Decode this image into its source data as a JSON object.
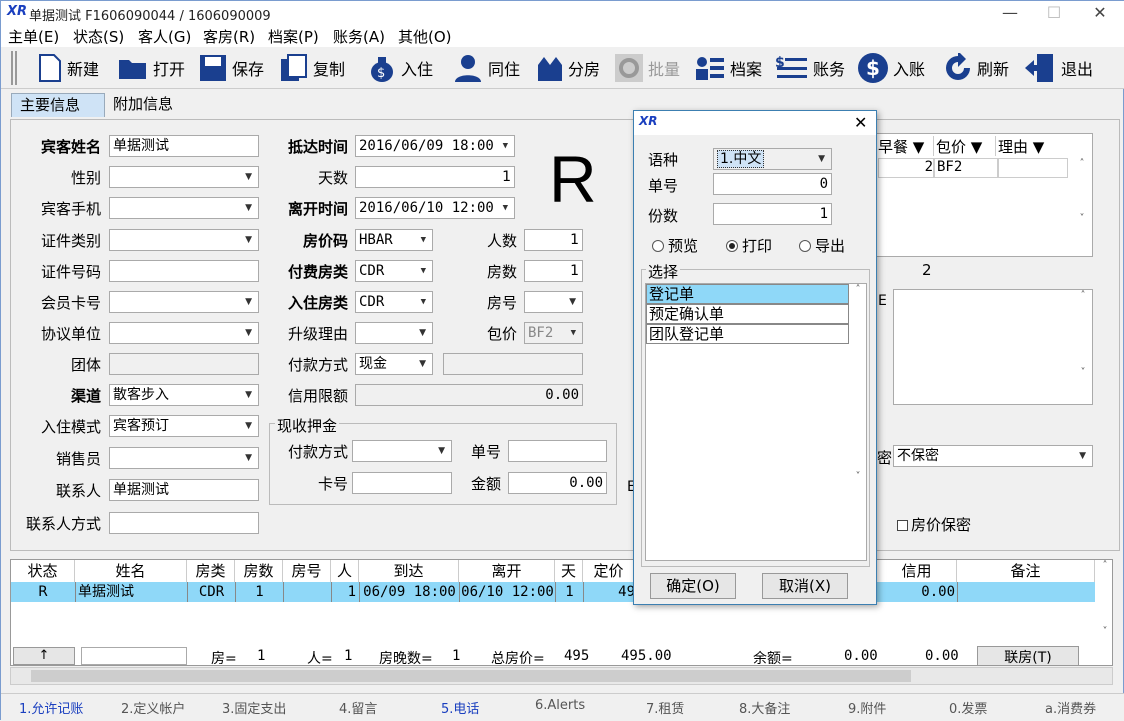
{
  "window": {
    "title": "单据测试  F1606090044  /  1606090009"
  },
  "menu": [
    "主单(E)",
    "状态(S)",
    "客人(G)",
    "客房(R)",
    "档案(P)",
    "账务(A)",
    "其他(O)"
  ],
  "toolbar": {
    "new": "新建",
    "open": "打开",
    "save": "保存",
    "copy": "复制",
    "checkin": "入住",
    "share": "同住",
    "split": "分房",
    "batch": "批量",
    "profile": "档案",
    "account": "账务",
    "post": "入账",
    "refresh": "刷新",
    "exit": "退出"
  },
  "tabs": {
    "main": "主要信息",
    "extra": "附加信息"
  },
  "form": {
    "guest_name_label": "宾客姓名",
    "guest_name": "单据测试",
    "gender_label": "性别",
    "mobile_label": "宾客手机",
    "id_type_label": "证件类别",
    "id_no_label": "证件号码",
    "member_label": "会员卡号",
    "company_label": "协议单位",
    "group_label": "团体",
    "channel_label": "渠道",
    "channel": "散客步入",
    "mode_label": "入住模式",
    "mode": "宾客预订",
    "sales_label": "销售员",
    "contact_label": "联系人",
    "contact": "单据测试",
    "contact_way_label": "联系人方式",
    "arrival_label": "抵达时间",
    "arrival": "2016/06/09 18:00",
    "days_label": "天数",
    "days": "1",
    "departure_label": "离开时间",
    "departure": "2016/06/10 12:00",
    "ratecode_label": "房价码",
    "ratecode": "HBAR",
    "pay_roomtype_label": "付费房类",
    "pay_roomtype": "CDR",
    "roomtype_label": "入住房类",
    "roomtype": "CDR",
    "upgrade_label": "升级理由",
    "payment_label": "付款方式",
    "payment": "现金",
    "credit_label": "信用限额",
    "credit": "0.00",
    "persons_label": "人数",
    "persons": "1",
    "rooms_label": "房数",
    "rooms": "1",
    "roomno_label": "房号",
    "package_label": "包价",
    "package": "BF2",
    "deposit_group": "现收押金",
    "dep_pay_label": "付款方式",
    "dep_card_label": "卡号",
    "dep_no_label": "单号",
    "dep_amount_label": "金额",
    "dep_amount": "0.00",
    "big_status": "R",
    "right_cols": [
      "早餐 ▼",
      "包价 ▼",
      "理由 ▼"
    ],
    "right_row": [
      "2",
      "BF2",
      ""
    ],
    "right_count": "2",
    "secret_value": "不保密",
    "rate_secret": "房价保密",
    "partial_label_e": "E",
    "partial_label_ia": "E",
    "partial_label_mi": "密"
  },
  "grid": {
    "headers": [
      "状态",
      "姓名",
      "房类",
      "房数",
      "房号",
      "人",
      "到达",
      "离开",
      "天",
      "定价",
      "信用",
      "备注"
    ],
    "row": [
      "R",
      "单据测试",
      "CDR",
      "1",
      "",
      "1",
      "06/09 18:00",
      "06/10 12:00",
      "1",
      "49",
      "0.00",
      ""
    ],
    "footer": {
      "up": "↑",
      "rooms": "房=",
      "rooms_val": "1",
      "persons": "人=",
      "persons_val": "1",
      "nights": "房晚数=",
      "nights_val": "1",
      "total": "总房价=",
      "total_val": "495",
      "total_val2": "495.00",
      "balance": "余额=",
      "balance_val": "0.00",
      "balance_val2": "0.00",
      "link": "联房(T)"
    }
  },
  "bottom_tabs": [
    "1.允许记账",
    "2.定义帐户",
    "3.固定支出",
    "4.留言",
    "5.电话",
    "6.Alerts",
    "7.租赁",
    "8.大备注",
    "9.附件",
    "0.发票",
    "a.消费券"
  ],
  "dialog": {
    "language_label": "语种",
    "language": "1.中文",
    "doc_no_label": "单号",
    "doc_no": "0",
    "copies_label": "份数",
    "copies": "1",
    "preview": "预览",
    "print": "打印",
    "export": "导出",
    "select_label": "选择",
    "items": [
      "登记单",
      "预定确认单",
      "团队登记单"
    ],
    "ok": "确定(O)",
    "cancel": "取消(X)"
  },
  "colors": {
    "selection": "#8fd8f8",
    "tab_active": "#cfe3f6",
    "brand": "#1a3fbf"
  }
}
